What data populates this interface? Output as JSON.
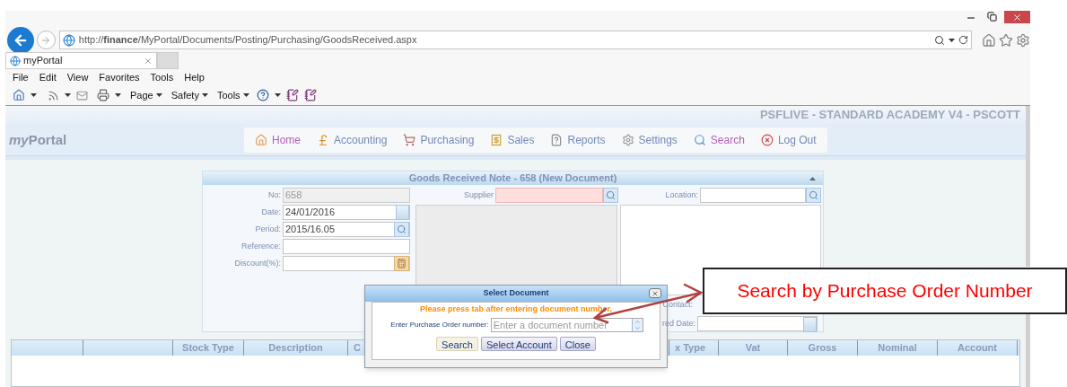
{
  "address_bar": {
    "url": "http://**finance**/MyPortal/Documents/Posting/Purchasing/GoodsReceived.aspx"
  },
  "tabs": [
    {
      "label": "myPortal",
      "selected": true
    }
  ],
  "menu": [
    "File",
    "Edit",
    "View",
    "Favorites",
    "Tools",
    "Help"
  ],
  "command_bar": [
    "Page",
    "Safety",
    "Tools"
  ],
  "portal": {
    "environment": "PSFLIVE - STANDARD ACADEMY V4 - PSCOTT",
    "logo": [
      "my",
      "Portal"
    ]
  },
  "nav": [
    {
      "label": "Home",
      "highlighted": true,
      "kind": "home"
    },
    {
      "label": "Accounting",
      "highlighted": false,
      "kind": "accounting"
    },
    {
      "label": "Purchasing",
      "highlighted": false,
      "kind": "purchasing"
    },
    {
      "label": "Sales",
      "highlighted": false,
      "kind": "sales"
    },
    {
      "label": "Reports",
      "highlighted": false,
      "kind": "reports"
    },
    {
      "label": "Settings",
      "highlighted": false,
      "kind": "settings"
    },
    {
      "label": "Search",
      "highlighted": true,
      "kind": "search"
    },
    {
      "label": "Log Out",
      "highlighted": false,
      "kind": "logout"
    }
  ],
  "form": {
    "title": "Goods Received Note - 658 (New Document)",
    "fields": [
      {
        "label": "No:",
        "value": "658",
        "kind": "readonly"
      },
      {
        "label": "Date:",
        "value": "24/01/2016",
        "kind": "date"
      },
      {
        "label": "Period:",
        "value": "2015/16.05",
        "kind": "lookup"
      },
      {
        "label": "Reference:",
        "kind": "plain"
      },
      {
        "label": "Discount(%):",
        "kind": "calc"
      }
    ],
    "supplier": {
      "label": "Supplier",
      "invalid": true
    },
    "location": {
      "label": "Location:",
      "invalid": false
    },
    "contact_label": "Contact:",
    "date_label": "red Date:"
  },
  "grid": {
    "columns": [
      "Stock Type",
      "Description",
      "C",
      "x Type",
      "Vat",
      "Gross",
      "Nominal",
      "Account"
    ]
  },
  "dialog": {
    "title": "Select Document",
    "notice": "Please press tab after entering document number.",
    "field_label": "Enter Purchase Order number:",
    "placeholder": "Enter a document number",
    "buttons": [
      {
        "label": "Search",
        "focused": true
      },
      {
        "label": "Select Account",
        "focused": false
      },
      {
        "label": "Close",
        "focused": false
      }
    ]
  },
  "annotation": {
    "text": "Search by Purchase Order Number"
  }
}
